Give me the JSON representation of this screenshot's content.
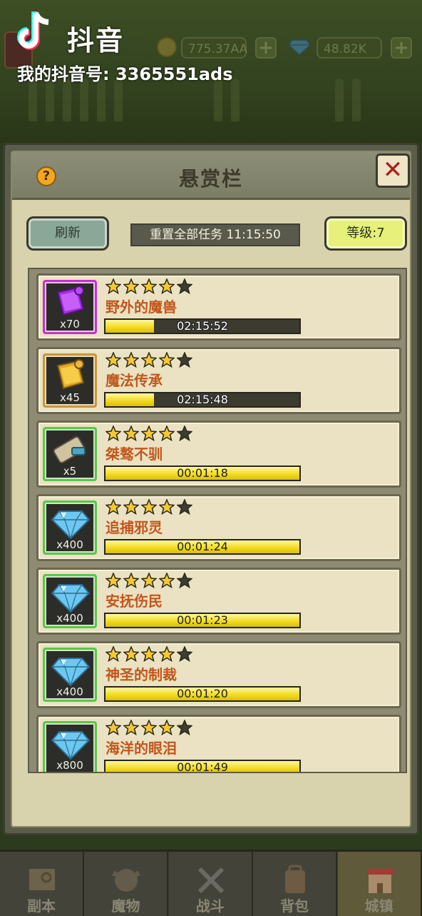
{
  "watermark": {
    "app_name": "抖音",
    "account_id": "我的抖音号: 3365551ads"
  },
  "resources": {
    "gold": "775.37AA",
    "diamonds": "48.82K"
  },
  "panel": {
    "title": "悬赏栏",
    "refresh_label": "刷新",
    "reset_timer": "重置全部任务 11:15:50",
    "level_label": "等级:7"
  },
  "missions": [
    {
      "name": "野外的魔兽",
      "reward": "x70",
      "reward_icon": "purple-scroll-icon",
      "stars": 4,
      "progress": 0.25,
      "time": "02:15:52"
    },
    {
      "name": "魔法传承",
      "reward": "x45",
      "reward_icon": "gold-scroll-icon",
      "stars": 4,
      "progress": 0.25,
      "time": "02:15:48"
    },
    {
      "name": "桀骜不驯",
      "reward": "x5",
      "reward_icon": "rolled-scroll-icon",
      "stars": 4,
      "progress": 1.0,
      "time": "00:01:18"
    },
    {
      "name": "追捕邪灵",
      "reward": "x400",
      "reward_icon": "diamond-icon",
      "stars": 4,
      "progress": 1.0,
      "time": "00:01:24"
    },
    {
      "name": "安抚伤民",
      "reward": "x400",
      "reward_icon": "diamond-icon",
      "stars": 4,
      "progress": 1.0,
      "time": "00:01:23"
    },
    {
      "name": "神圣的制裁",
      "reward": "x400",
      "reward_icon": "diamond-icon",
      "stars": 4,
      "progress": 1.0,
      "time": "00:01:20"
    },
    {
      "name": "海洋的眼泪",
      "reward": "x800",
      "reward_icon": "diamond-icon",
      "stars": 4,
      "progress": 1.0,
      "time": "00:01:49"
    }
  ],
  "nav": [
    {
      "label": "副本",
      "icon": "map-icon"
    },
    {
      "label": "魔物",
      "icon": "monster-icon"
    },
    {
      "label": "战斗",
      "icon": "crossed-swords-icon"
    },
    {
      "label": "背包",
      "icon": "backpack-icon"
    },
    {
      "label": "城镇",
      "icon": "town-icon",
      "active": true
    }
  ],
  "colors": {
    "star_filled": "#f4c832",
    "star_empty": "#3f3d30",
    "mission_name": "#c2561c",
    "bar_fill": "#f2d91a"
  }
}
